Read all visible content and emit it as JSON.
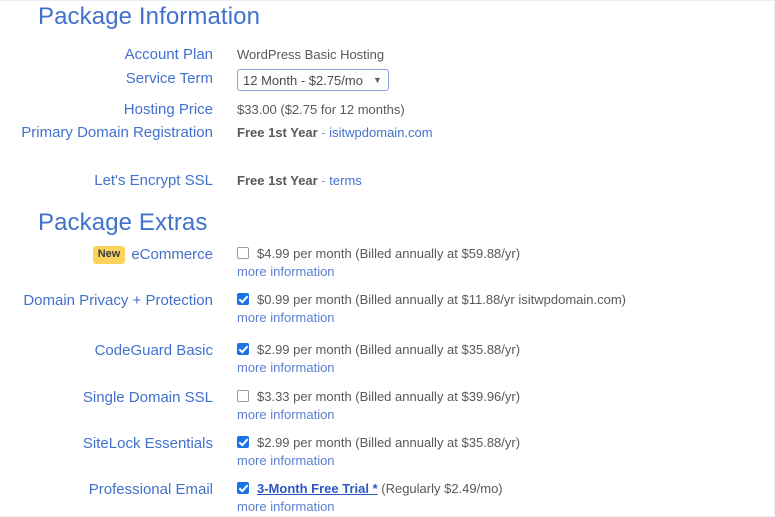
{
  "sections": {
    "package_information": {
      "title": "Package Information",
      "rows": [
        {
          "label": "Account Plan",
          "type": "text",
          "value": "WordPress Basic Hosting"
        },
        {
          "label": "Service Term",
          "type": "select",
          "selected": "12 Month - $2.75/mo",
          "caret": "chevron-down-icon"
        },
        {
          "label": "Hosting Price",
          "type": "text",
          "value": "$33.00 ($2.75 for 12 months)"
        },
        {
          "label": "Primary Domain Registration",
          "type": "bold-link",
          "bold": "Free 1st Year",
          "separator": " - ",
          "link": "isitwpdomain.com"
        },
        {
          "label": "Let's Encrypt SSL",
          "type": "bold-link",
          "bold": "Free 1st Year",
          "separator": " - ",
          "link": "terms"
        }
      ]
    },
    "package_extras": {
      "title": "Package Extras",
      "more_info_label": "more information",
      "items": [
        {
          "badge": "New",
          "label": "eCommerce",
          "checked": false,
          "price": "$4.99 per month (Billed annually at $59.88/yr)",
          "more_info": "more information"
        },
        {
          "badge": "",
          "label": "Domain Privacy + Protection",
          "checked": true,
          "price": "$0.99 per month (Billed annually at $11.88/yr isitwpdomain.com)",
          "more_info": "more information"
        },
        {
          "badge": "",
          "label": "CodeGuard Basic",
          "checked": true,
          "price": "$2.99 per month (Billed annually at $35.88/yr)",
          "more_info": "more information"
        },
        {
          "badge": "",
          "label": "Single Domain SSL",
          "checked": false,
          "price": "$3.33 per month (Billed annually at $39.96/yr)",
          "more_info": "more information"
        },
        {
          "badge": "",
          "label": "SiteLock Essentials",
          "checked": true,
          "price": "$2.99 per month (Billed annually at $35.88/yr)",
          "more_info": "more information"
        },
        {
          "badge": "",
          "label": "Professional Email",
          "checked": true,
          "trial_link": "3-Month Free Trial *",
          "trial_note": " (Regularly $2.49/mo)",
          "more_info": "more information"
        }
      ]
    }
  },
  "colors": {
    "heading_blue": "#4271cd",
    "label_blue": "#4271cd",
    "link_blue": "#5a7fd4",
    "checkbox_blue": "#1a73e8",
    "badge_yellow": "#fbd35c",
    "text_gray": "#58595b"
  }
}
